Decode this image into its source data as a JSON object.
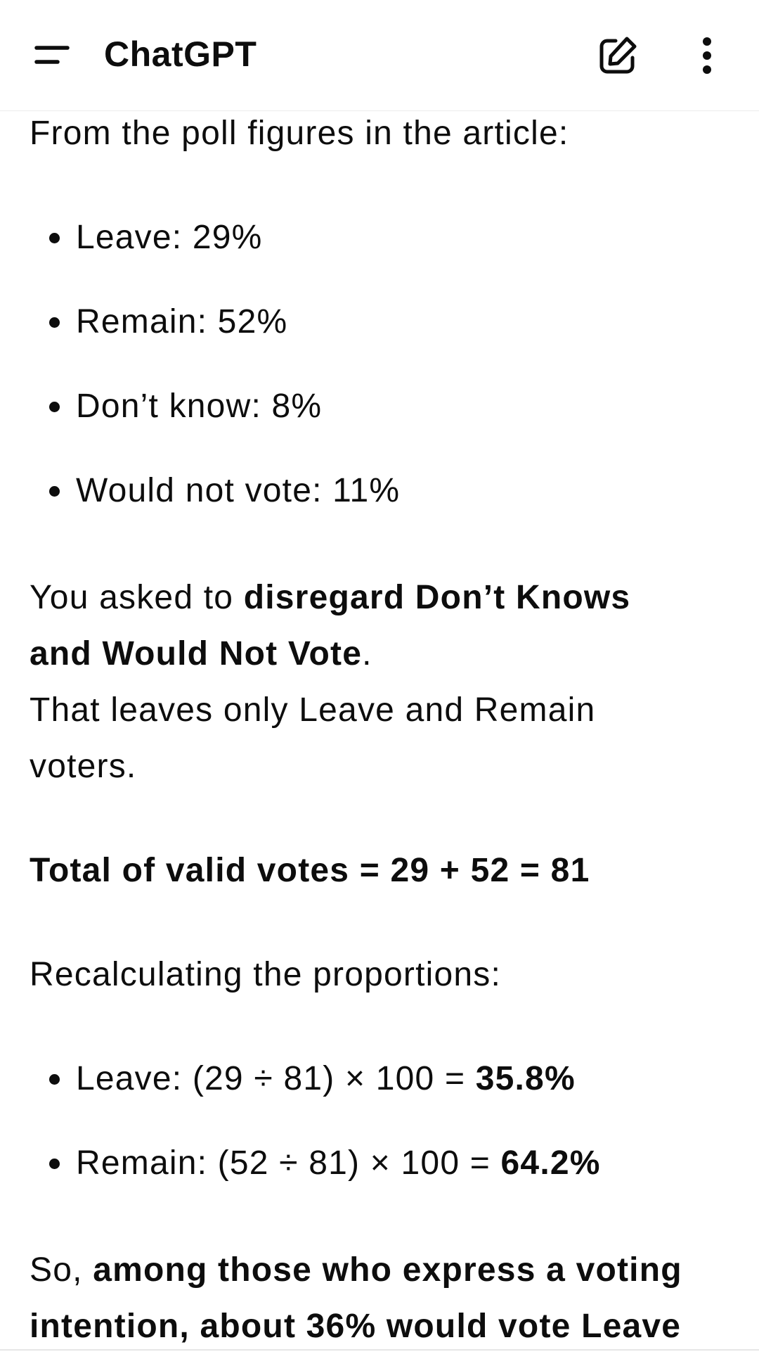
{
  "header": {
    "title": "ChatGPT",
    "menu_icon": "menu-icon",
    "new_chat_icon": "new-chat-icon",
    "more_icon": "more-vertical-icon"
  },
  "message": {
    "intro": "From the poll figures in the article:",
    "poll_items": [
      "Leave: 29%",
      "Remain: 52%",
      "Don’t know: 8%",
      "Would not vote: 11%"
    ],
    "disregard_pre": "You asked to ",
    "disregard_bold_1": "disregard Don’t Knows",
    "disregard_bold_2": "and Would Not Vote",
    "disregard_post": ".",
    "leaves_line_1": "That leaves only Leave and Remain",
    "leaves_line_2": "voters.",
    "total": "Total of valid votes = 29 + 52 = 81",
    "recalc": "Recalculating the proportions:",
    "results": [
      {
        "calc": "Leave: (29 ÷ 81) × 100 = ",
        "value": "35.8%"
      },
      {
        "calc": "Remain: (52 ÷ 81) × 100 = ",
        "value": "64.2%"
      }
    ],
    "conclusion_pre": "So, ",
    "conclusion_bold_1": "among those who express a voting",
    "conclusion_bold_2": "intention, about 36% would vote Leave"
  }
}
